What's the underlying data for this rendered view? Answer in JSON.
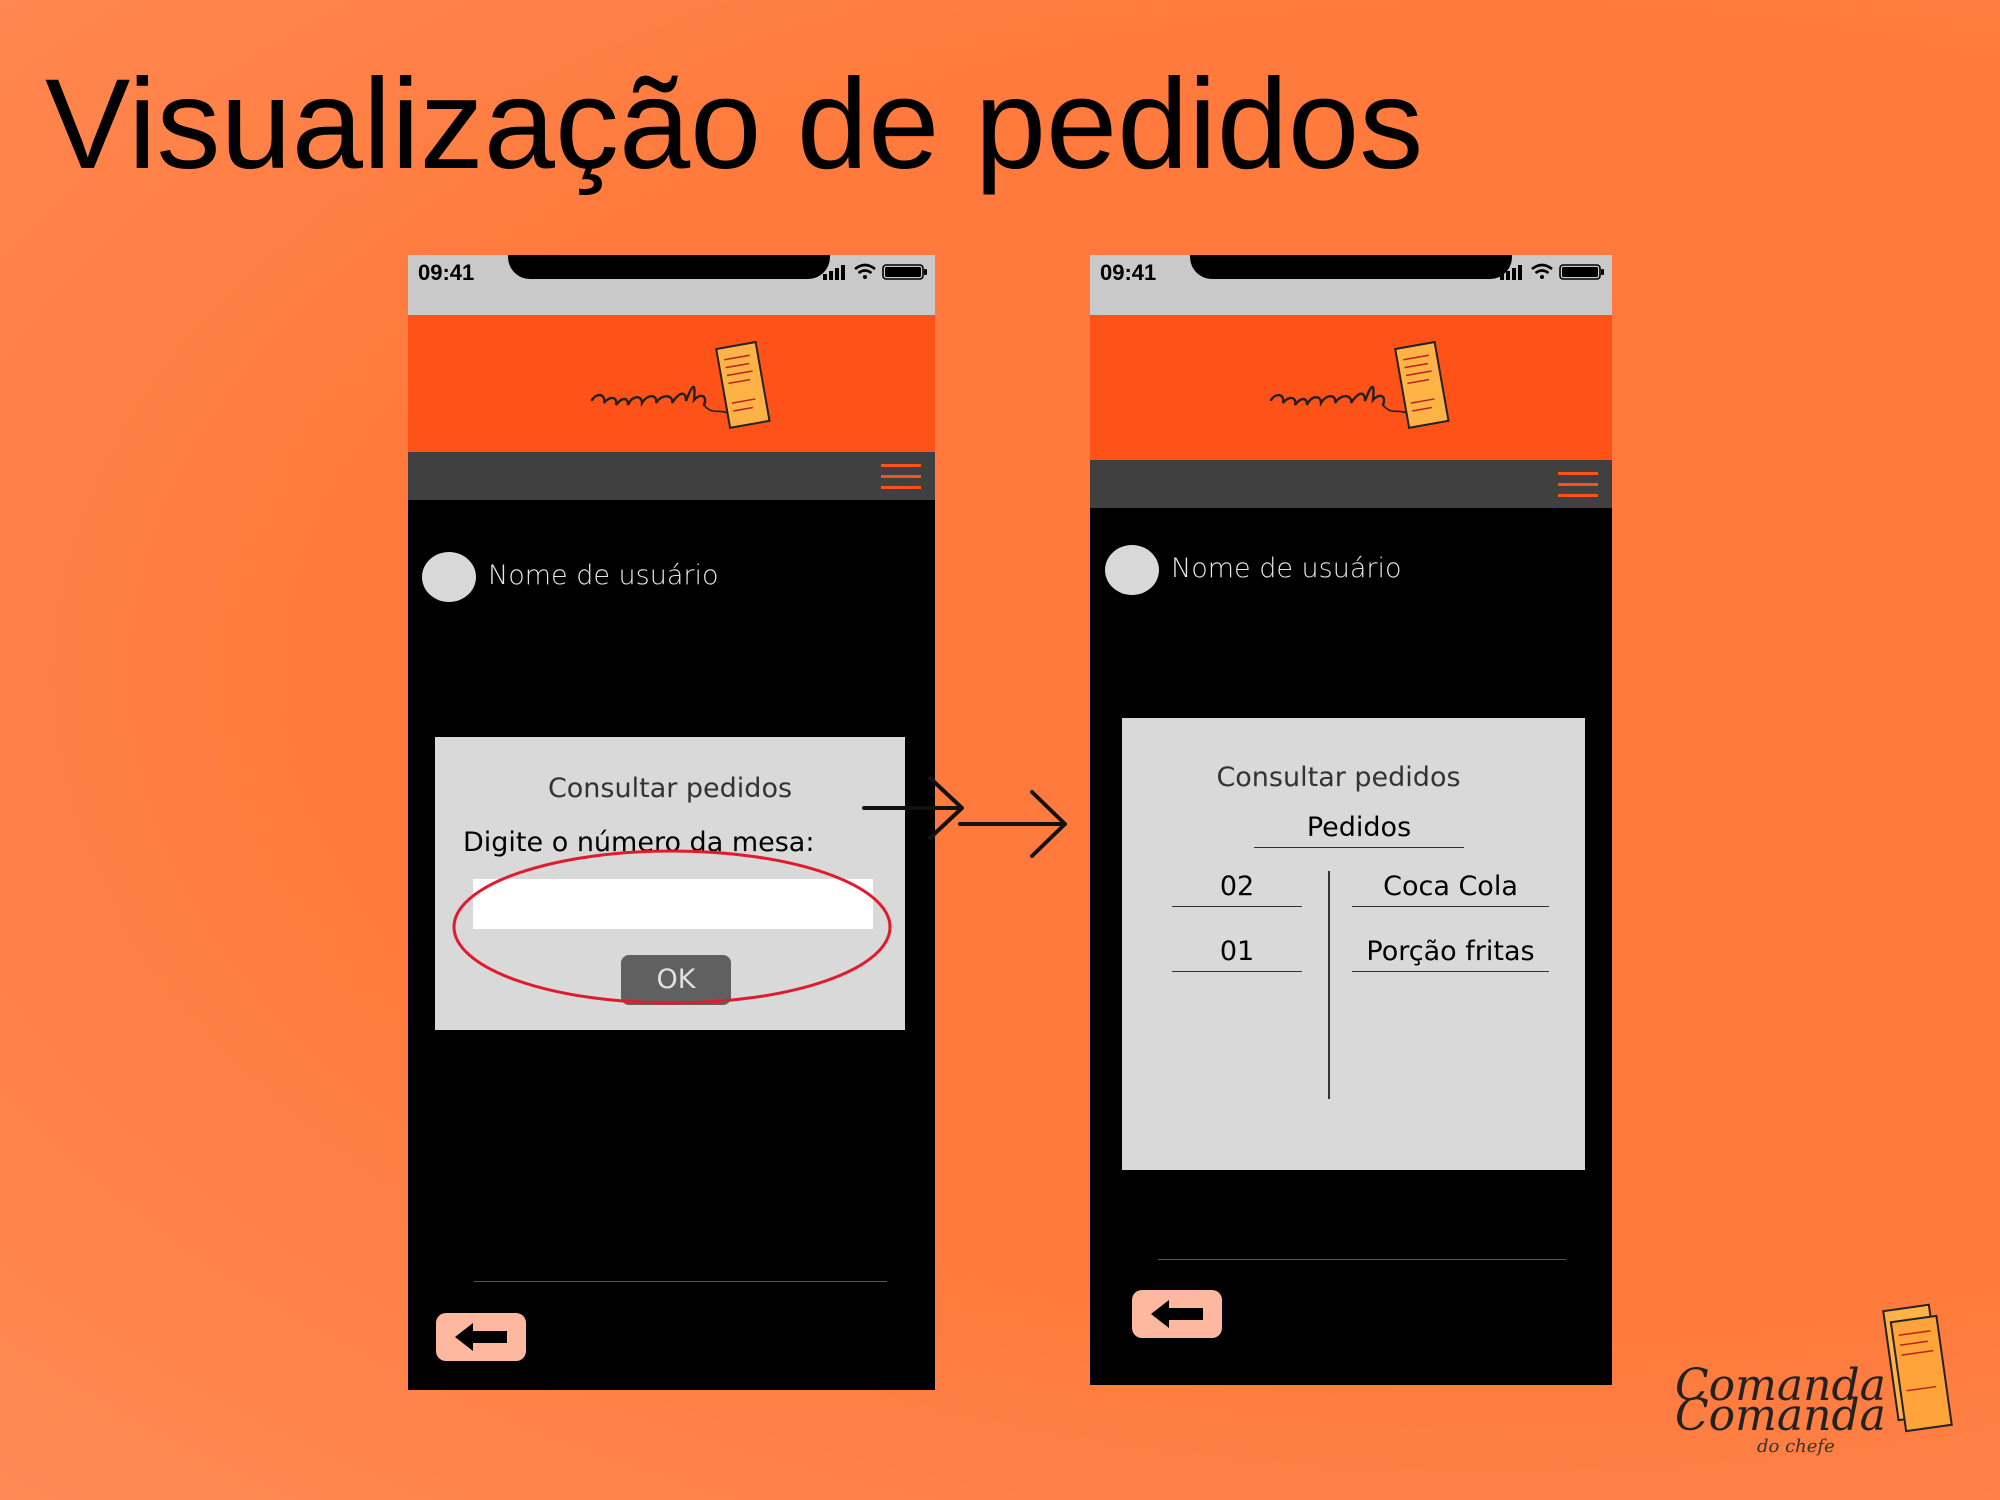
{
  "slide": {
    "title": "Visualização de pedidos"
  },
  "status_bar": {
    "time": "09:41"
  },
  "user": {
    "name": "Nome de usuário"
  },
  "brand": {
    "logo_text": "Comanda",
    "logo_subtext": "do chefe"
  },
  "screen_lookup": {
    "dialog_title": "Consultar pedidos",
    "prompt": "Digite o número da mesa:",
    "table_number_value": "",
    "ok_label": "OK"
  },
  "screen_orders": {
    "dialog_title": "Consultar pedidos",
    "orders_heading": "Pedidos",
    "orders": [
      {
        "qty": "02",
        "item": "Coca Cola"
      },
      {
        "qty": "01",
        "item": "Porção fritas"
      }
    ]
  },
  "colors": {
    "background": "#ff7a3c",
    "header": "#ff5219",
    "nav_bar": "#404040",
    "dialog": "#d9d9d9",
    "back_button": "#ffb8a0",
    "highlight": "#e01a2f"
  }
}
